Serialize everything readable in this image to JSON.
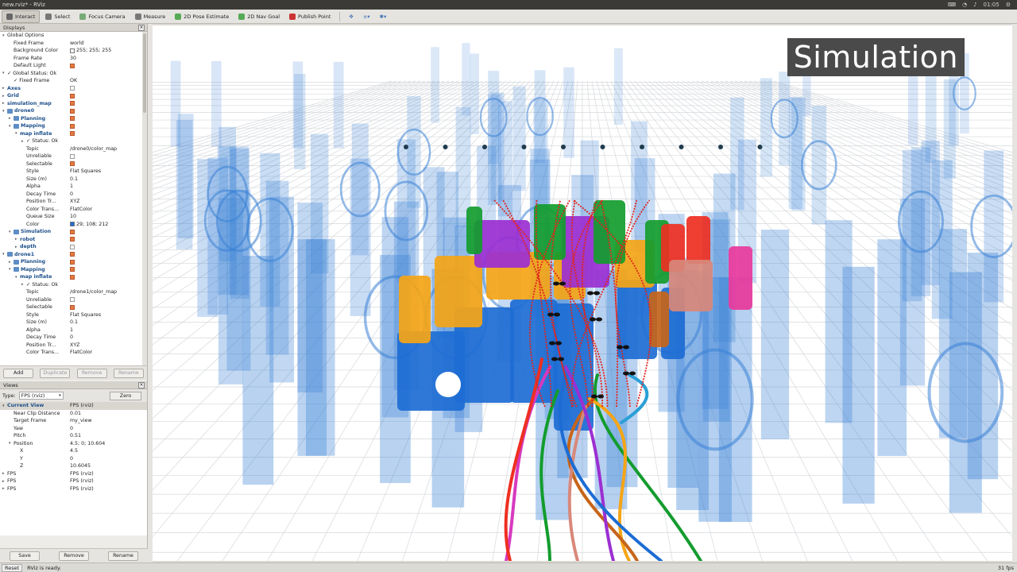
{
  "window": {
    "title": "new.rviz* - RViz",
    "clock": "01:05"
  },
  "toolbar": [
    {
      "label": "Interact",
      "icon": "interact-icon",
      "active": true
    },
    {
      "label": "Select",
      "icon": "select-icon"
    },
    {
      "label": "Focus Camera",
      "icon": "focus-camera-icon"
    },
    {
      "label": "Measure",
      "icon": "measure-icon"
    },
    {
      "label": "2D Pose Estimate",
      "icon": "pose-estimate-icon"
    },
    {
      "label": "2D Nav Goal",
      "icon": "nav-goal-icon"
    },
    {
      "label": "Publish Point",
      "icon": "publish-point-icon"
    }
  ],
  "displays": {
    "title": "Displays",
    "rows": [
      {
        "i": 0,
        "a": "▾",
        "k": "Global Options",
        "v": "",
        "b": false
      },
      {
        "i": 1,
        "k": "Fixed Frame",
        "v": "world"
      },
      {
        "i": 1,
        "k": "Background Color",
        "v": "255; 255; 255",
        "sw": "#ffffff"
      },
      {
        "i": 1,
        "k": "Frame Rate",
        "v": "30"
      },
      {
        "i": 1,
        "k": "Default Light",
        "cb": true
      },
      {
        "i": 0,
        "a": "▾",
        "k": "✓ Global Status: Ok"
      },
      {
        "i": 1,
        "k": "✓ Fixed Frame",
        "v": "OK"
      },
      {
        "i": 0,
        "a": "▸",
        "k": "Axes",
        "b": true,
        "cb": false
      },
      {
        "i": 0,
        "a": "▸",
        "k": "Grid",
        "b": true,
        "cb": true
      },
      {
        "i": 0,
        "a": "▸",
        "k": "simulation_map",
        "b": true,
        "cb": true
      },
      {
        "i": 0,
        "a": "▾",
        "k": "drone0",
        "b": true,
        "cb": true,
        "f": true
      },
      {
        "i": 1,
        "a": "▸",
        "k": "Planning",
        "b": true,
        "cb": true,
        "f": true
      },
      {
        "i": 1,
        "a": "▾",
        "k": "Mapping",
        "b": true,
        "cb": true,
        "f": true
      },
      {
        "i": 2,
        "a": "▾",
        "k": "map inflate",
        "b": true,
        "cb": true
      },
      {
        "i": 3,
        "a": "▸",
        "k": "✓ Status: Ok"
      },
      {
        "i": 3,
        "k": "Topic",
        "v": "/drone0/color_map"
      },
      {
        "i": 3,
        "k": "Unreliable",
        "cb": false
      },
      {
        "i": 3,
        "k": "Selectable",
        "cb": true
      },
      {
        "i": 3,
        "k": "Style",
        "v": "Flat Squares"
      },
      {
        "i": 3,
        "k": "Size (m)",
        "v": "0.1"
      },
      {
        "i": 3,
        "k": "Alpha",
        "v": "1"
      },
      {
        "i": 3,
        "k": "Decay Time",
        "v": "0"
      },
      {
        "i": 3,
        "k": "Position Tr...",
        "v": "XYZ"
      },
      {
        "i": 3,
        "k": "Color Trans...",
        "v": "FlatColor"
      },
      {
        "i": 3,
        "k": "Queue Size",
        "v": "10"
      },
      {
        "i": 3,
        "k": "Color",
        "v": "29; 108; 212",
        "sw": "#1d6cd4"
      },
      {
        "i": 1,
        "a": "▾",
        "k": "Simulation",
        "b": true,
        "cb": true,
        "f": true
      },
      {
        "i": 2,
        "a": "▸",
        "k": "robot",
        "b": true,
        "cb": true
      },
      {
        "i": 2,
        "a": "▸",
        "k": "depth",
        "b": true,
        "cb": false
      },
      {
        "i": 0,
        "a": "▾",
        "k": "drone1",
        "b": true,
        "cb": true,
        "f": true
      },
      {
        "i": 1,
        "a": "▸",
        "k": "Planning",
        "b": true,
        "cb": true,
        "f": true
      },
      {
        "i": 1,
        "a": "▾",
        "k": "Mapping",
        "b": true,
        "cb": true,
        "f": true
      },
      {
        "i": 2,
        "a": "▾",
        "k": "map inflate",
        "b": true,
        "cb": true
      },
      {
        "i": 3,
        "a": "▸",
        "k": "✓ Status: Ok"
      },
      {
        "i": 3,
        "k": "Topic",
        "v": "/drone1/color_map"
      },
      {
        "i": 3,
        "k": "Unreliable",
        "cb": false
      },
      {
        "i": 3,
        "k": "Selectable",
        "cb": true
      },
      {
        "i": 3,
        "k": "Style",
        "v": "Flat Squares"
      },
      {
        "i": 3,
        "k": "Size (m)",
        "v": "0.1"
      },
      {
        "i": 3,
        "k": "Alpha",
        "v": "1"
      },
      {
        "i": 3,
        "k": "Decay Time",
        "v": "0"
      },
      {
        "i": 3,
        "k": "Position Tr...",
        "v": "XYZ"
      },
      {
        "i": 3,
        "k": "Color Trans...",
        "v": "FlatColor"
      }
    ],
    "buttons": [
      "Add",
      "Duplicate",
      "Remove",
      "Rename"
    ]
  },
  "views": {
    "title": "Views",
    "type_label": "Type:",
    "type_value": "FPS (rviz)",
    "zero": "Zero",
    "rows": [
      {
        "i": 0,
        "a": "▾",
        "k": "Current View",
        "v": "FPS (rviz)",
        "sel": true,
        "b": true
      },
      {
        "i": 1,
        "k": "Near Clip Distance",
        "v": "0.01"
      },
      {
        "i": 1,
        "k": "Target Frame",
        "v": "my_view"
      },
      {
        "i": 1,
        "k": "Yaw",
        "v": "0"
      },
      {
        "i": 1,
        "k": "Pitch",
        "v": "0.51"
      },
      {
        "i": 1,
        "a": "▾",
        "k": "Position",
        "v": "4.5; 0; 10.604"
      },
      {
        "i": 2,
        "k": "X",
        "v": "4.5"
      },
      {
        "i": 2,
        "k": "Y",
        "v": "0"
      },
      {
        "i": 2,
        "k": "Z",
        "v": "10.6045"
      },
      {
        "i": 0,
        "a": "▸",
        "k": "FPS",
        "v": "FPS (rviz)"
      },
      {
        "i": 0,
        "a": "▸",
        "k": "FPS",
        "v": "FPS (rviz)"
      },
      {
        "i": 0,
        "a": "▸",
        "k": "FPS",
        "v": "FPS (rviz)"
      }
    ],
    "buttons": [
      "Save",
      "Remove",
      "Rename"
    ]
  },
  "viewport": {
    "badge": "Simulation"
  },
  "status": {
    "reset": "Reset",
    "message": "RViz is ready.",
    "fps": "31 fps"
  }
}
